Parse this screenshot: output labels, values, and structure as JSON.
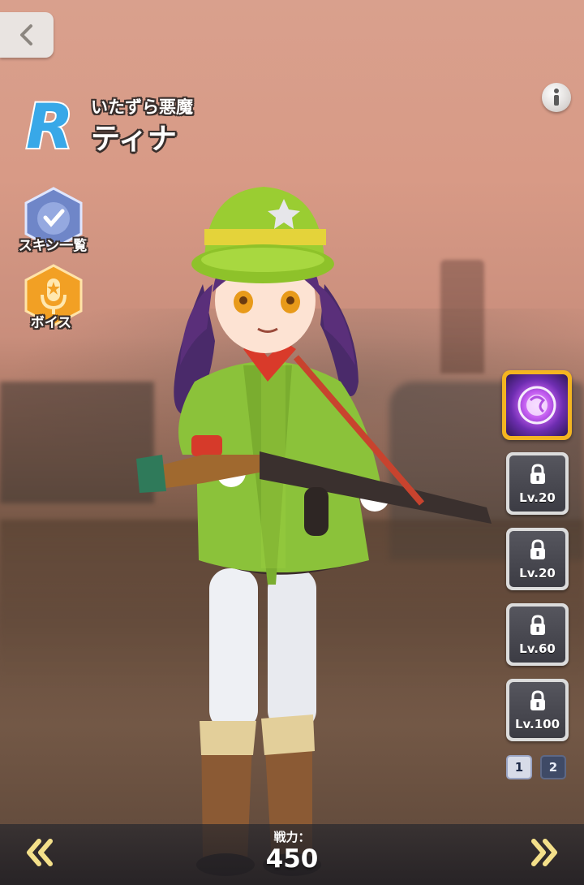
{
  "header": {
    "rarity": "R",
    "title": "いたずら悪魔",
    "name": "ティナ"
  },
  "side_menu": {
    "skins_label": "スキン一覧",
    "voice_label": "ボイス"
  },
  "skills": {
    "slots": [
      {
        "state": "active",
        "icon": "skill-orb-icon"
      },
      {
        "state": "locked",
        "level": "Lv.20"
      },
      {
        "state": "locked",
        "level": "Lv.20"
      },
      {
        "state": "locked",
        "level": "Lv.60"
      },
      {
        "state": "locked",
        "level": "Lv.100"
      }
    ],
    "pages": [
      "1",
      "2"
    ],
    "current_page": "1"
  },
  "footer": {
    "power_label": "戦力：",
    "power_value": "450"
  },
  "colors": {
    "rarity_blue": "#38a8e8",
    "skill_active_border": "#f3b521",
    "voice_orange": "#f2a024",
    "skin_blue": "#6f86c8"
  }
}
